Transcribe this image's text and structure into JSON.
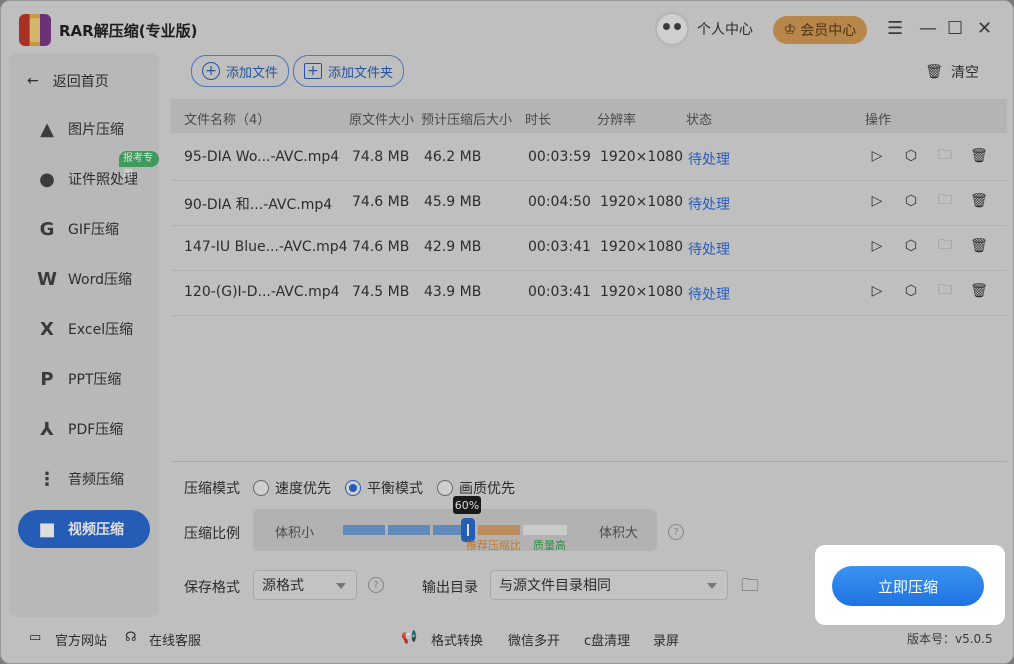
{
  "app": {
    "title": "RAR解压缩(专业版)"
  },
  "header": {
    "user_center": "个人中心",
    "vip_center": "会员中心"
  },
  "sidebar": {
    "back": "返回首页",
    "badge": "报考专用",
    "items": [
      {
        "label": "图片压缩",
        "icon": "image-icon"
      },
      {
        "label": "证件照处理",
        "icon": "id-photo-icon"
      },
      {
        "label": "GIF压缩",
        "icon": "gif-icon"
      },
      {
        "label": "Word压缩",
        "icon": "word-icon"
      },
      {
        "label": "Excel压缩",
        "icon": "excel-icon"
      },
      {
        "label": "PPT压缩",
        "icon": "ppt-icon"
      },
      {
        "label": "PDF压缩",
        "icon": "pdf-icon"
      },
      {
        "label": "音频压缩",
        "icon": "audio-icon"
      },
      {
        "label": "视频压缩",
        "icon": "video-icon",
        "active": true
      }
    ]
  },
  "toolbar": {
    "add_file": "添加文件",
    "add_folder": "添加文件夹",
    "clear": "清空"
  },
  "table": {
    "headers": [
      "文件名称（4）",
      "原文件大小",
      "预计压缩后大小",
      "时长",
      "分辨率",
      "状态",
      "操作"
    ],
    "rows": [
      {
        "name": "95-DIA Wo...-AVC.mp4",
        "orig": "74.8 MB",
        "est": "46.2 MB",
        "dur": "00:03:59",
        "res": "1920×1080",
        "status": "待处理"
      },
      {
        "name": "90-DIA 和...-AVC.mp4",
        "orig": "74.6 MB",
        "est": "45.9 MB",
        "dur": "00:04:50",
        "res": "1920×1080",
        "status": "待处理"
      },
      {
        "name": "147-IU Blue...-AVC.mp4",
        "orig": "74.6 MB",
        "est": "42.9 MB",
        "dur": "00:03:41",
        "res": "1920×1080",
        "status": "待处理"
      },
      {
        "name": "120-(G)I-D...-AVC.mp4",
        "orig": "74.5 MB",
        "est": "43.9 MB",
        "dur": "00:03:41",
        "res": "1920×1080",
        "status": "待处理"
      }
    ]
  },
  "settings": {
    "mode_label": "压缩模式",
    "modes": [
      "速度优先",
      "平衡模式",
      "画质优先"
    ],
    "selected_mode": "平衡模式",
    "ratio_label": "压缩比例",
    "ratio_min": "体积小",
    "ratio_max": "体积大",
    "ratio_value": "60%",
    "ratio_fraction": 0.6,
    "recommend": "推荐压缩比",
    "quality_high": "质量高",
    "format_label": "保存格式",
    "format_value": "源格式",
    "output_label": "输出目录",
    "output_value": "与源文件目录相同"
  },
  "cta": {
    "label": "立即压缩"
  },
  "footer": {
    "website": "官方网站",
    "support": "在线客服",
    "format_convert": "格式转换",
    "wechat_multi": "微信多开",
    "c_clean": "c盘清理",
    "record": "录屏",
    "version": "版本号：v5.0.5"
  },
  "colors": {
    "accent": "#2b6bd1",
    "status": "#2f6bd8",
    "vip": "#d39a55",
    "recommend": "#e08a2e",
    "quality": "#3aa655"
  }
}
